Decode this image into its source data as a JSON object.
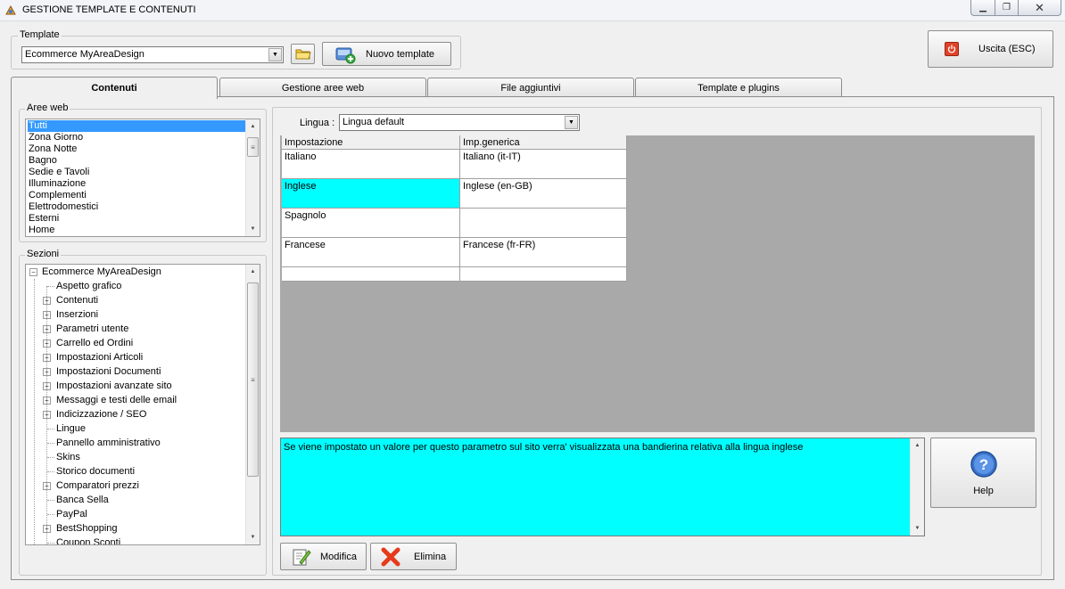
{
  "window": {
    "title": "GESTIONE TEMPLATE E CONTENUTI"
  },
  "template_group": {
    "label": "Template",
    "selected": "Ecommerce MyAreaDesign",
    "new_button": "Nuovo template"
  },
  "exit_button": "Uscita (ESC)",
  "tabs": [
    "Contenuti",
    "Gestione aree web",
    "File aggiuntivi",
    "Template e plugins"
  ],
  "aree_web": {
    "label": "Aree web",
    "items": [
      "Tutti",
      "Zona Giorno",
      "Zona Notte",
      "Bagno",
      "Sedie e Tavoli",
      "Illuminazione",
      "Complementi",
      "Elettrodomestici",
      "Esterni",
      "Home"
    ]
  },
  "sezioni": {
    "label": "Sezioni",
    "root": "Ecommerce MyAreaDesign",
    "items": [
      {
        "label": "Aspetto grafico",
        "expandable": false
      },
      {
        "label": "Contenuti",
        "expandable": true
      },
      {
        "label": "Inserzioni",
        "expandable": true
      },
      {
        "label": "Parametri utente",
        "expandable": true
      },
      {
        "label": "Carrello ed Ordini",
        "expandable": true
      },
      {
        "label": "Impostazioni Articoli",
        "expandable": true
      },
      {
        "label": "Impostazioni Documenti",
        "expandable": true
      },
      {
        "label": "Impostazioni avanzate sito",
        "expandable": true
      },
      {
        "label": "Messaggi e testi delle email",
        "expandable": true
      },
      {
        "label": "Indicizzazione / SEO",
        "expandable": true
      },
      {
        "label": "Lingue",
        "expandable": false
      },
      {
        "label": "Pannello amministrativo",
        "expandable": false
      },
      {
        "label": "Skins",
        "expandable": false
      },
      {
        "label": "Storico documenti",
        "expandable": false
      },
      {
        "label": "Comparatori prezzi",
        "expandable": true
      },
      {
        "label": "Banca Sella",
        "expandable": false
      },
      {
        "label": "PayPal",
        "expandable": false
      },
      {
        "label": "BestShopping",
        "expandable": true
      },
      {
        "label": "Coupon Sconti",
        "expandable": false
      }
    ]
  },
  "lingua": {
    "label": "Lingua :",
    "selected": "Lingua default"
  },
  "grid": {
    "headers": [
      "Impostazione",
      "Imp.generica"
    ],
    "rows": [
      [
        "Italiano",
        "Italiano (it-IT)"
      ],
      [
        "Inglese",
        "Inglese (en-GB)"
      ],
      [
        "Spagnolo",
        ""
      ],
      [
        "Francese",
        "Francese (fr-FR)"
      ],
      [
        "",
        ""
      ]
    ],
    "highlight_color": "#00ffff"
  },
  "description": "Se viene impostato un valore per questo parametro sul sito verra' visualizzata una bandierina relativa alla lingua inglese",
  "help_button": "Help",
  "modifica_button": "Modifica",
  "elimina_button": "Elimina"
}
